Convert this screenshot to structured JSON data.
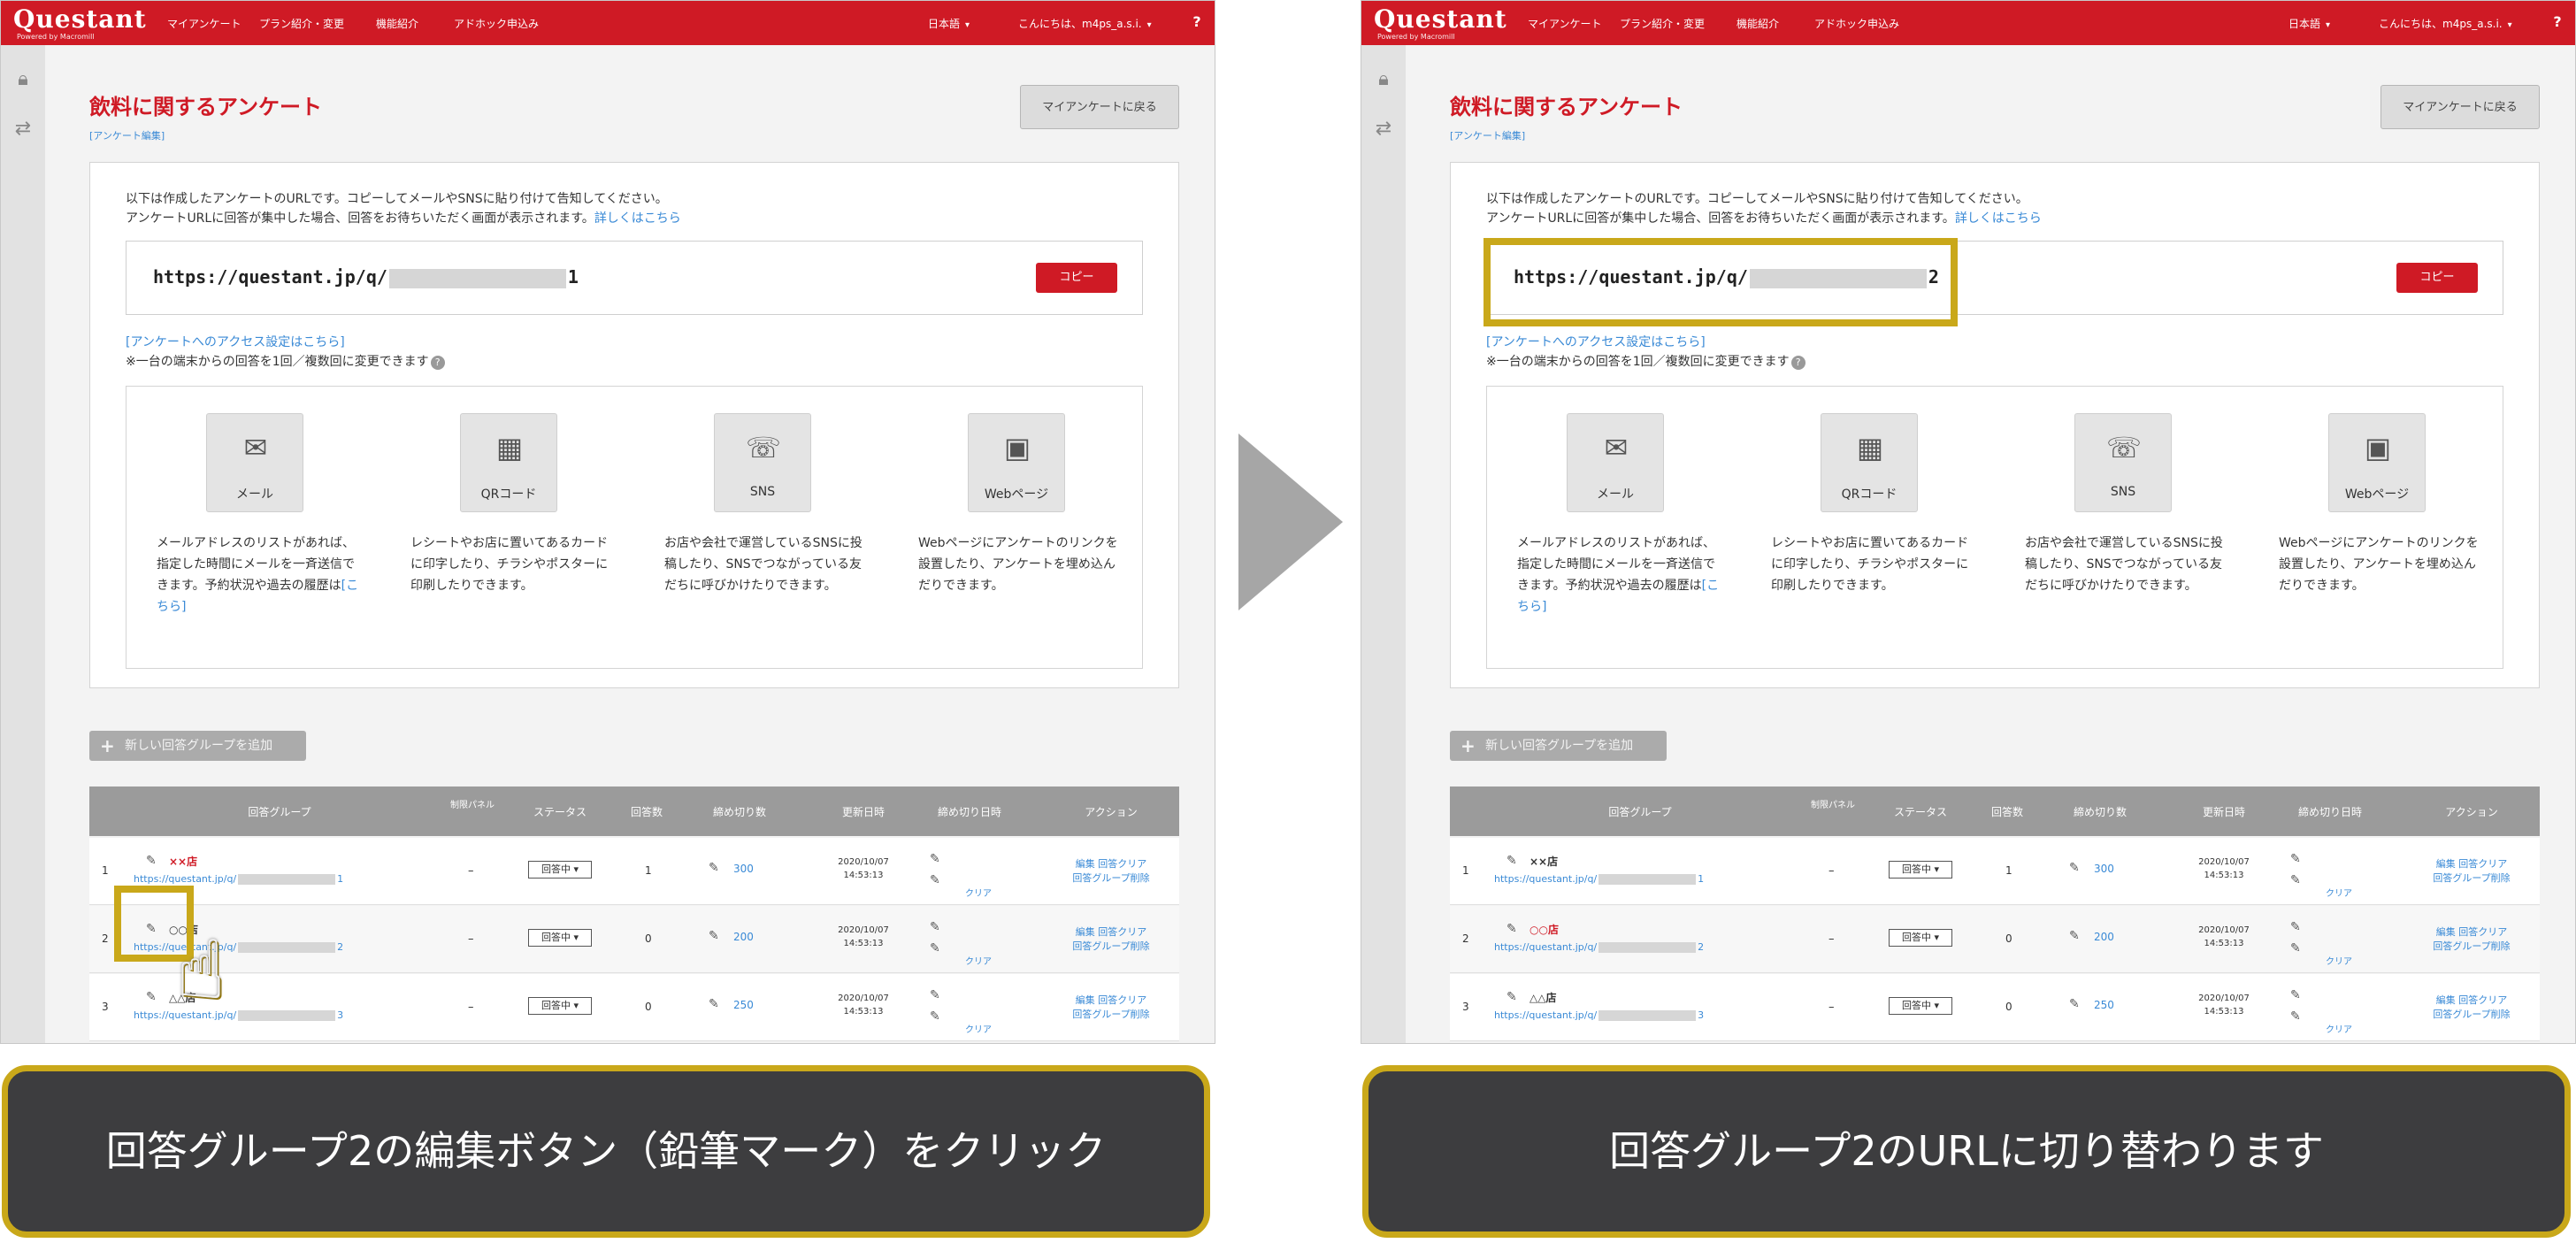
{
  "app": {
    "logo": "Questant",
    "logo_sub": "Powered by Macromill",
    "nav": [
      "マイアンケート",
      "プラン紹介・変更",
      "機能紹介",
      "アドホック申込み"
    ],
    "language": "日本語",
    "greeting": "こんにちは、",
    "greeting_name": "m4ps_a.s.i.",
    "help": "?"
  },
  "page": {
    "title": "飲料に関するアンケート",
    "breadcrumb": "[アンケート編集]",
    "back_button": "マイアンケートに戻る",
    "description_1": "以下は作成したアンケートのURLです。コピーしてメールやSNSに貼り付けて告知してください。",
    "description_2": "アンケートURLに回答が集中した場合、回答をお待ちいただく画面が表示されます。",
    "description_link": "詳しくはこちら",
    "url_prefix": "https://questant.jp/q/",
    "url_suffix_left": "1",
    "url_suffix_right": "2",
    "copy_button": "コピー",
    "access_link": "[アンケートへのアクセス設定はこちら]",
    "access_note": "※一台の端末からの回答を1回／複数回に変更できます",
    "methods": [
      {
        "label": "メール",
        "icon": "mail-icon",
        "glyph": "✉",
        "desc": "メールアドレスのリストがあれば、指定した時間にメールを一斉送信できます。予約状況や過去の履歴は",
        "link": "[こちら]"
      },
      {
        "label": "QRコード",
        "icon": "qr-code-icon",
        "glyph": "▦",
        "desc": "レシートやお店に置いてあるカードに印字したり、チラシやポスターに印刷したりできます。",
        "link": ""
      },
      {
        "label": "SNS",
        "icon": "sns-icon",
        "glyph": "☏",
        "desc": "お店や会社で運営しているSNSに投稿したり、SNSでつながっている友だちに呼びかけたりできます。",
        "link": ""
      },
      {
        "label": "Webページ",
        "icon": "web-page-icon",
        "glyph": "▣",
        "desc": "Webページにアンケートのリンクを設置したり、アンケートを埋め込んだりできます。",
        "link": ""
      }
    ],
    "add_group": "新しい回答グループを追加",
    "table_headers": [
      "回答グループ",
      "制限パネル",
      "ステータス",
      "回答数",
      "締め切り数",
      "更新日時",
      "締め切り日時",
      "アクション"
    ],
    "rows_left": [
      {
        "no": "1",
        "name": "××店",
        "url": "https://questant.jp/q/",
        "url_end": "1",
        "limit": "–",
        "status": "回答中",
        "count": "1",
        "target": "300",
        "date": "2020/10/07 14:53:13",
        "clear": "クリア",
        "action_1": "編集 回答クリア",
        "action_2": "回答グループ削除"
      },
      {
        "no": "2",
        "name": "○○店",
        "url": "https://questant.jp/q/",
        "url_end": "2",
        "limit": "–",
        "status": "回答中",
        "count": "0",
        "target": "200",
        "date": "2020/10/07 14:53:13",
        "clear": "クリア",
        "action_1": "編集 回答クリア",
        "action_2": "回答グループ削除"
      },
      {
        "no": "3",
        "name": "△△店",
        "url": "https://questant.jp/q/",
        "url_end": "3",
        "limit": "–",
        "status": "回答中",
        "count": "0",
        "target": "250",
        "date": "2020/10/07 14:53:13",
        "clear": "クリア",
        "action_1": "編集 回答クリア",
        "action_2": "回答グループ削除"
      }
    ],
    "rows_right": [
      {
        "no": "1",
        "name": "××店",
        "url": "https://questant.jp/q/",
        "url_end": "1",
        "limit": "–",
        "status": "回答中",
        "count": "1",
        "target": "300",
        "date": "2020/10/07 14:53:13",
        "clear": "クリア",
        "action_1": "編集 回答クリア",
        "action_2": "回答グループ削除"
      },
      {
        "no": "2",
        "name": "○○店",
        "url": "https://questant.jp/q/",
        "url_end": "2",
        "limit": "–",
        "status": "回答中",
        "count": "0",
        "target": "200",
        "date": "2020/10/07 14:53:13",
        "clear": "クリア",
        "action_1": "編集 回答クリア",
        "action_2": "回答グループ削除"
      },
      {
        "no": "3",
        "name": "△△店",
        "url": "https://questant.jp/q/",
        "url_end": "3",
        "limit": "–",
        "status": "回答中",
        "count": "0",
        "target": "250",
        "date": "2020/10/07 14:53:13",
        "clear": "クリア",
        "action_1": "編集 回答クリア",
        "action_2": "回答グループ削除"
      }
    ]
  },
  "captions": {
    "left": "回答グループ2の編集ボタン（鉛筆マーク）をクリック",
    "right": "回答グループ2のURLに切り替わります"
  },
  "colors": {
    "brand_red": "#cf1a25",
    "highlight_gold": "#c9a81a",
    "caption_bg": "#3d3d3f",
    "arrow_gray": "#a6a6a6"
  }
}
